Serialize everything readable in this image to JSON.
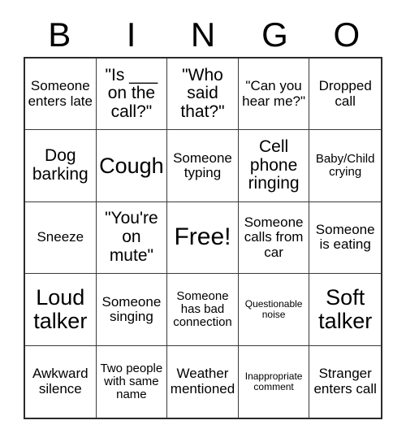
{
  "card": {
    "header_letters": [
      "B",
      "I",
      "N",
      "G",
      "O"
    ],
    "columns": 5,
    "rows": 5,
    "free_space_label": "Free!",
    "free_space_position": {
      "row": 3,
      "column": 3
    },
    "border_color": "#2b2b2b",
    "grid_line_color": "#3a3a3a",
    "background_color": "#ffffff",
    "text_color": "#000000",
    "squares": [
      [
        {
          "text": "Someone enters late",
          "size": "sm"
        },
        {
          "text": "\"Is ___ on the call?\"",
          "size": "md"
        },
        {
          "text": "\"Who said that?\"",
          "size": "md"
        },
        {
          "text": "\"Can you hear me?\"",
          "size": "sm"
        },
        {
          "text": "Dropped call",
          "size": "sm"
        }
      ],
      [
        {
          "text": "Dog barking",
          "size": "md"
        },
        {
          "text": "Cough",
          "size": "lg"
        },
        {
          "text": "Someone typing",
          "size": "sm"
        },
        {
          "text": "Cell phone ringing",
          "size": "md"
        },
        {
          "text": "Baby/Child crying",
          "size": "xs"
        }
      ],
      [
        {
          "text": "Sneeze",
          "size": "sm"
        },
        {
          "text": "\"You're on mute\"",
          "size": "md"
        },
        {
          "text": "Free!",
          "size": "xl"
        },
        {
          "text": "Someone calls from car",
          "size": "sm"
        },
        {
          "text": "Someone is eating",
          "size": "sm"
        }
      ],
      [
        {
          "text": "Loud talker",
          "size": "lg"
        },
        {
          "text": "Someone singing",
          "size": "sm"
        },
        {
          "text": "Someone has bad connection",
          "size": "xs"
        },
        {
          "text": "Questionable noise",
          "size": "xxs"
        },
        {
          "text": "Soft talker",
          "size": "lg"
        }
      ],
      [
        {
          "text": "Awkward silence",
          "size": "sm"
        },
        {
          "text": "Two people with same name",
          "size": "xs"
        },
        {
          "text": "Weather mentioned",
          "size": "sm"
        },
        {
          "text": "Inappropriate comment",
          "size": "xxs"
        },
        {
          "text": "Stranger enters call",
          "size": "sm"
        }
      ]
    ]
  }
}
